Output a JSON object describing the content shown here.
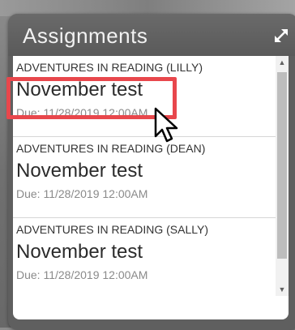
{
  "widget": {
    "title": "Assignments",
    "icons": {
      "expand": "expand-icon",
      "scroll_up": "chevron-up-icon",
      "scroll_down": "chevron-down-icon",
      "cursor": "mouse-pointer-icon"
    },
    "colors": {
      "highlight": "#e8474c",
      "header_bg": "#5f5f5f",
      "title_text": "#f2f2f2"
    }
  },
  "assignments": [
    {
      "class": "ADVENTURES IN READING (LILLY)",
      "title": "November test",
      "due": "Due: 11/28/2019 12:00AM"
    },
    {
      "class": "ADVENTURES IN READING (DEAN)",
      "title": "November test",
      "due": "Due: 11/28/2019 12:00AM"
    },
    {
      "class": "ADVENTURES IN READING (SALLY)",
      "title": "November test",
      "due": "Due: 11/28/2019 12:00AM"
    }
  ]
}
